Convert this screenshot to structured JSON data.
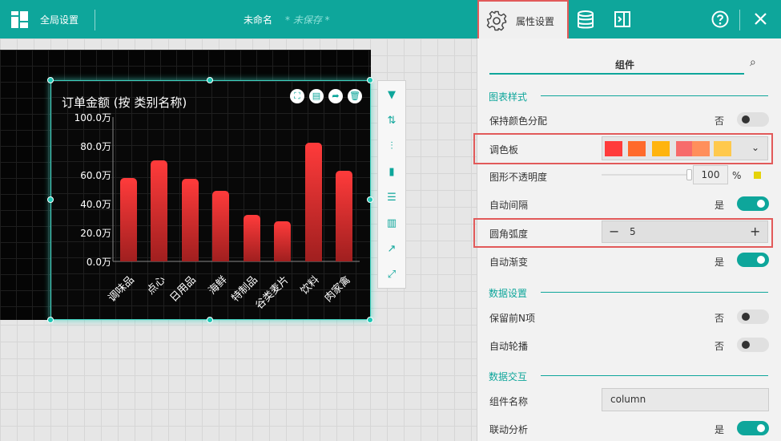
{
  "topbar": {
    "global_settings_label": "全局设置",
    "doc_title": "未命名",
    "unsaved_label": "* 未保存 *",
    "attr_settings_label": "属性设置"
  },
  "chart": {
    "title": "订单金额 (按 类别名称)"
  },
  "chart_data": {
    "type": "bar",
    "title": "订单金额 (按 类别名称)",
    "categories": [
      "调味品",
      "点心",
      "日用品",
      "海鲜",
      "特制品",
      "谷类麦片",
      "饮料",
      "肉家禽"
    ],
    "values": [
      58000,
      70000,
      57000,
      49000,
      32000,
      28000,
      82000,
      63000
    ],
    "yticks": [
      "0.0万",
      "20.0万",
      "40.0万",
      "60.0万",
      "80.0万",
      "100.0万"
    ],
    "ylim": [
      0,
      100000
    ],
    "bar_color": "#e02a2a"
  },
  "panel": {
    "tab_label": "组件",
    "sections": {
      "chart_style": "图表样式",
      "data_settings": "数据设置",
      "data_interaction": "数据交互"
    },
    "rows": {
      "keep_color": {
        "label": "保持颜色分配",
        "value": "否"
      },
      "palette": {
        "label": "调色板",
        "colors": [
          "#ff3b3b",
          "#ff6a2b",
          "#ffb40e",
          "#f76b6b",
          "#ff8f5c",
          "#ffc94d"
        ]
      },
      "opacity": {
        "label": "图形不透明度",
        "value": "100",
        "unit": "%",
        "value_number": 100
      },
      "auto_gap": {
        "label": "自动间隔",
        "value": "是"
      },
      "corner": {
        "label": "圆角弧度",
        "value": "5"
      },
      "auto_gradient": {
        "label": "自动渐变",
        "value": "是"
      },
      "keep_top_n": {
        "label": "保留前N项",
        "value": "否"
      },
      "auto_carousel": {
        "label": "自动轮播",
        "value": "否"
      },
      "component_name": {
        "label": "组件名称",
        "value": "column"
      },
      "linked_analysis": {
        "label": "联动分析",
        "value": "是"
      }
    }
  },
  "colors": {
    "accent": "#0ea69b",
    "highlight": "#e25a5a"
  }
}
